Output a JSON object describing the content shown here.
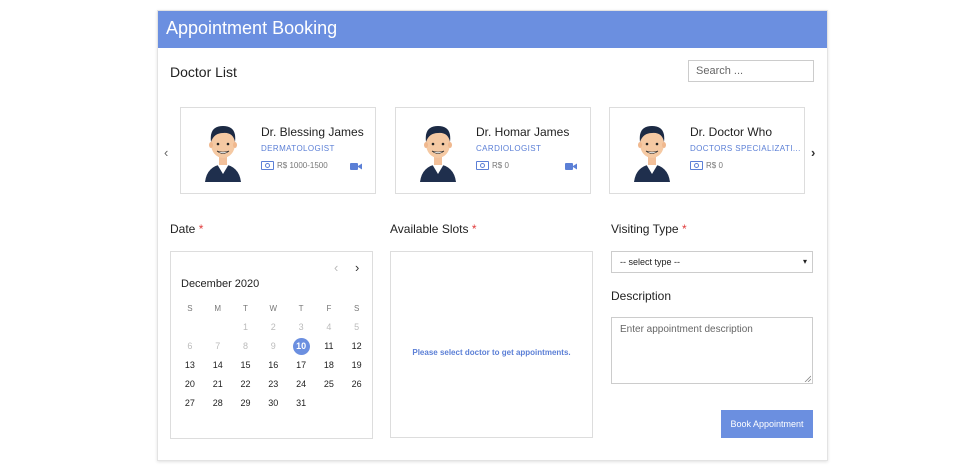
{
  "header": {
    "title": "Appointment Booking"
  },
  "doctor_list": {
    "title": "Doctor List",
    "search_placeholder": "Search ...",
    "doctors": [
      {
        "name": "Dr. Blessing James",
        "specialization": "DERMATOLOGIST",
        "fee": "R$ 1000-1500",
        "video": true
      },
      {
        "name": "Dr. Homar James",
        "specialization": "CARDIOLOGIST",
        "fee": "R$ 0",
        "video": true
      },
      {
        "name": "Dr. Doctor Who",
        "specialization": "DOCTORS SPECIALIZATI...",
        "fee": "R$ 0",
        "video": false
      }
    ],
    "prev_icon": "chevron-left-icon",
    "next_icon": "chevron-right-icon"
  },
  "date": {
    "label": "Date",
    "required_mark": "*",
    "month": "December 2020",
    "weekdays": [
      "S",
      "M",
      "T",
      "W",
      "T",
      "F",
      "S"
    ],
    "weeks": [
      [
        "",
        "",
        "1",
        "2",
        "3",
        "4",
        "5"
      ],
      [
        "6",
        "7",
        "8",
        "9",
        "10",
        "11",
        "12"
      ],
      [
        "13",
        "14",
        "15",
        "16",
        "17",
        "18",
        "19"
      ],
      [
        "20",
        "21",
        "22",
        "23",
        "24",
        "25",
        "26"
      ],
      [
        "27",
        "28",
        "29",
        "30",
        "31",
        "",
        ""
      ]
    ],
    "selected_day": "10"
  },
  "slots": {
    "label": "Available Slots",
    "required_mark": "*",
    "message": "Please select doctor to get appointments."
  },
  "visiting_type": {
    "label": "Visiting Type",
    "required_mark": "*",
    "selected": "-- select type --"
  },
  "description": {
    "label": "Description",
    "placeholder": "Enter appointment description"
  },
  "book_button": "Book Appointment",
  "colors": {
    "accent": "#6b8fe0",
    "required": "#e03b3b"
  }
}
